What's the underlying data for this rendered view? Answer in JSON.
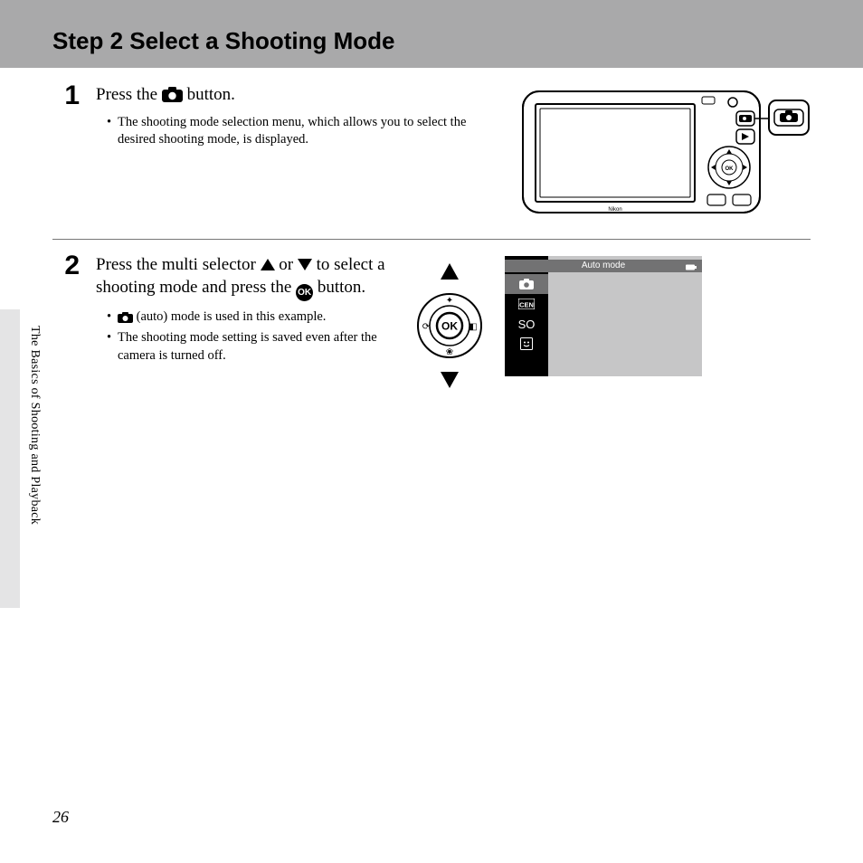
{
  "header": {
    "title": "Step 2 Select a Shooting Mode"
  },
  "sidebar": {
    "section_label": "The Basics of Shooting and Playback",
    "page_number": "26"
  },
  "steps": [
    {
      "num": "1",
      "title_pre": "Press the ",
      "title_post": " button.",
      "bullets": [
        "The shooting mode selection menu, which allows you to select the desired shooting mode, is displayed."
      ]
    },
    {
      "num": "2",
      "title_pre": "Press the multi selector ",
      "title_mid": " or ",
      "title_after_arrows": " to select a shooting mode and press the ",
      "title_post": " button.",
      "bullets_pre_icon": "",
      "bullet_after_icon": " (auto) mode is used in this example.",
      "bullets": [
        "The shooting mode setting is saved even after the camera is turned off."
      ]
    }
  ],
  "mode_screen": {
    "banner": "Auto mode",
    "items": [
      "camera",
      "scene",
      "SO",
      "smile"
    ]
  },
  "icons": {
    "ok_label": "OK"
  }
}
